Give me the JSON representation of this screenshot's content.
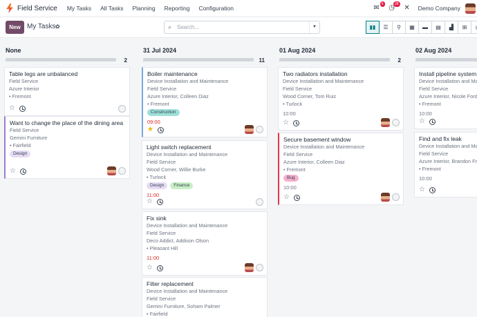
{
  "app": {
    "name": "Field Service",
    "company": "Demo Company"
  },
  "menu": [
    "My Tasks",
    "All Tasks",
    "Planning",
    "Reporting",
    "Configuration"
  ],
  "systray": {
    "messages_count": "6",
    "activities_count": "28"
  },
  "control": {
    "new_label": "New",
    "breadcrumb": "My Tasks",
    "search_placeholder": "Search..."
  },
  "views": [
    "kanban",
    "list",
    "map",
    "calendar",
    "gantt",
    "activity",
    "graph",
    "pivot",
    "cohort"
  ],
  "colors": {
    "brand": "#714b67",
    "accent": "#017e84",
    "late": "#dc2626",
    "star": "#f4b400"
  },
  "columns": [
    {
      "title": "None",
      "count": "2",
      "cards": [
        {
          "title": "Table legs are unbalanced",
          "lines": [
            "Field Service",
            "Azure Interior",
            "• Fremont"
          ],
          "tags": [],
          "time": "",
          "starred": false,
          "avatar": false,
          "accent": ""
        },
        {
          "title": "Want to change the place of the dining area",
          "lines": [
            "Field Service",
            "Gemini Furniture",
            "• Fairfield"
          ],
          "tags": [
            {
              "label": "Design",
              "color": "#e6dcf5"
            }
          ],
          "time": "",
          "starred": false,
          "avatar": true,
          "accent": "purple"
        }
      ]
    },
    {
      "title": "31 Jul 2024",
      "count": "11",
      "cards": [
        {
          "title": "Boiler maintenance",
          "lines": [
            "Device Installation and Maintenance",
            "Field Service",
            "Azure Interior, Colleen Diaz",
            "• Fremont"
          ],
          "tags": [
            {
              "label": "Construction",
              "color": "#9ee0d8"
            }
          ],
          "time": "09:00",
          "late": true,
          "starred": true,
          "avatar": true,
          "accent": "blue"
        },
        {
          "title": "Light switch replacement",
          "lines": [
            "Device Installation and Maintenance",
            "Field Service",
            "Wood Corner, Willie Burke",
            "• Turlock"
          ],
          "tags": [
            {
              "label": "Design",
              "color": "#e6dcf5"
            },
            {
              "label": "Finance",
              "color": "#c9efc5"
            }
          ],
          "time": "11:00",
          "late": true,
          "starred": false,
          "avatar": false,
          "accent": ""
        },
        {
          "title": "Fix sink",
          "lines": [
            "Device Installation and Maintenance",
            "Field Service",
            "Deco Addict, Addison Olson",
            "• Pleasant Hill"
          ],
          "tags": [],
          "time": "11:00",
          "late": true,
          "starred": false,
          "avatar": true,
          "accent": ""
        },
        {
          "title": "Filter replacement",
          "lines": [
            "Device Installation and Maintenance",
            "Field Service",
            "Gemini Furniture, Soham Palmer",
            "• Fairfield"
          ],
          "tags": [],
          "time": "",
          "starred": false,
          "avatar": false,
          "accent": ""
        }
      ]
    },
    {
      "title": "01 Aug 2024",
      "count": "2",
      "cards": [
        {
          "title": "Two radiators installation",
          "lines": [
            "Device Installation and Maintenance",
            "Field Service",
            "Wood Corner, Tom Ruiz",
            "• Turlock"
          ],
          "tags": [],
          "time": "10:00",
          "late": false,
          "starred": false,
          "avatar": true,
          "accent": ""
        },
        {
          "title": "Secure basement window",
          "lines": [
            "Device Installation and Maintenance",
            "Field Service",
            "Azure Interior, Colleen Diaz",
            "• Fremont"
          ],
          "tags": [
            {
              "label": "Bug",
              "color": "#f5b0cf"
            }
          ],
          "time": "10:00",
          "late": false,
          "starred": false,
          "avatar": true,
          "accent": "red"
        }
      ]
    },
    {
      "title": "02 Aug 2024",
      "count": "",
      "cards": [
        {
          "title": "Install pipeline system",
          "lines": [
            "Device Installation and Maintenance",
            "Field Service",
            "Azure Interior, Nicole Ford",
            "• Fremont"
          ],
          "tags": [],
          "time": "10:00",
          "late": false,
          "starred": false,
          "avatar": false,
          "accent": ""
        },
        {
          "title": "Find and fix leak",
          "lines": [
            "Device Installation and Maintenance",
            "Field Service",
            "Azure Interior, Brandon Freeman",
            "• Fremont"
          ],
          "tags": [],
          "time": "10:00",
          "late": false,
          "starred": false,
          "avatar": false,
          "accent": ""
        }
      ]
    }
  ]
}
